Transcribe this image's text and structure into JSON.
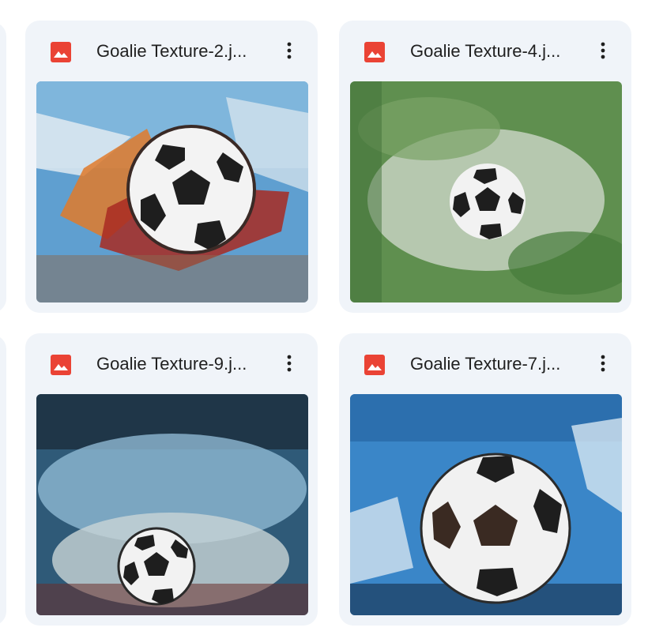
{
  "files": [
    {
      "name": "Goalie Texture-2.j...",
      "icon": "image-file-icon",
      "menu_icon": "more-vert-icon",
      "thumbnail": "soccer-ball-splash-blue"
    },
    {
      "name": "Goalie Texture-4.j...",
      "icon": "image-file-icon",
      "menu_icon": "more-vert-icon",
      "thumbnail": "soccer-ball-splash-green"
    },
    {
      "name": "Goalie Texture-9.j...",
      "icon": "image-file-icon",
      "menu_icon": "more-vert-icon",
      "thumbnail": "soccer-ball-splash-dark-blue"
    },
    {
      "name": "Goalie Texture-7.j...",
      "icon": "image-file-icon",
      "menu_icon": "more-vert-icon",
      "thumbnail": "soccer-ball-splash-light-blue"
    }
  ],
  "colors": {
    "card_background": "#f0f4f9",
    "image_icon": "#ea4335",
    "text": "#1f1f1f"
  }
}
